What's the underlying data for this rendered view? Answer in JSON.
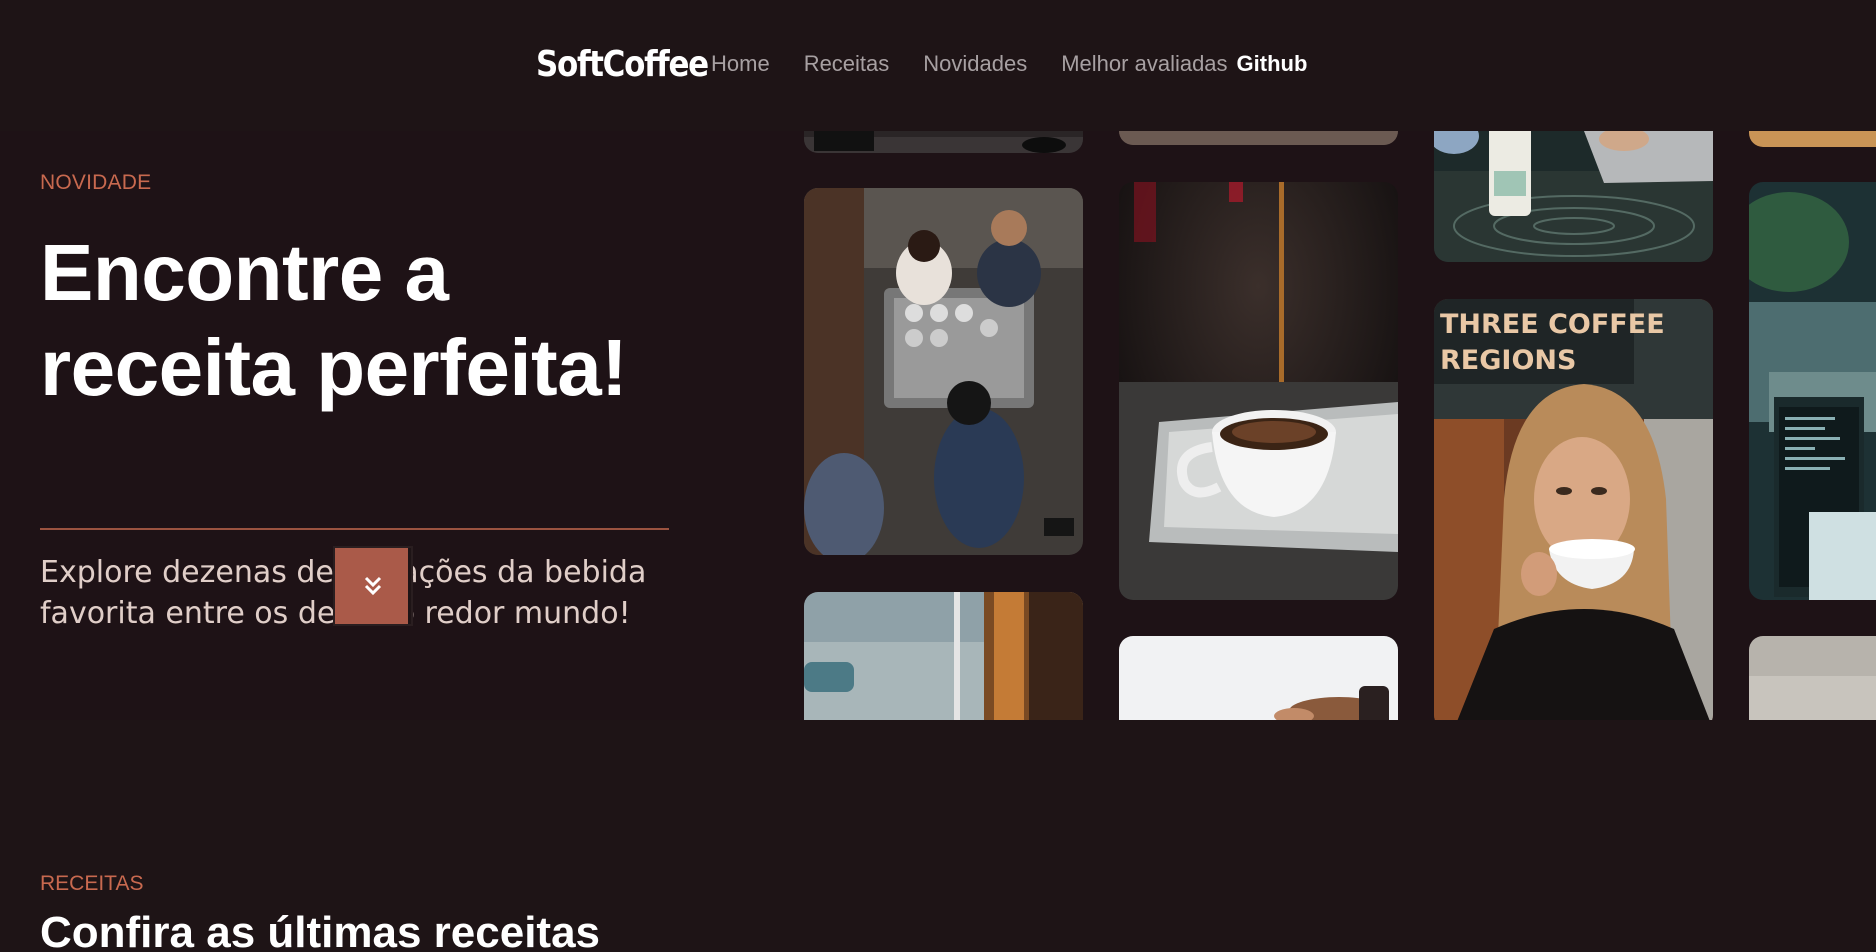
{
  "header": {
    "logo": "SoftCoffee",
    "nav": [
      "Home",
      "Receitas",
      "Novidades",
      "Melhor avaliadas",
      "Github"
    ]
  },
  "hero": {
    "eyebrow": "NOVIDADE",
    "title": "Encontre a receita perfeita!",
    "description": "Explore dezenas de variações da bebida favorita entre os devs ao redor mundo!",
    "button_icon": "chevrons-down-icon"
  },
  "gallery": {
    "images": [
      "baristas-at-espresso-machine",
      "cafe-window",
      "coffee-pouring-into-cup",
      "hands-holding-coffee",
      "laptop-and-coffee-cup",
      "woman-drinking-coffee",
      "developer-desk-screens"
    ]
  },
  "section": {
    "eyebrow": "RECEITAS",
    "title": "Confira as últimas receitas"
  }
}
